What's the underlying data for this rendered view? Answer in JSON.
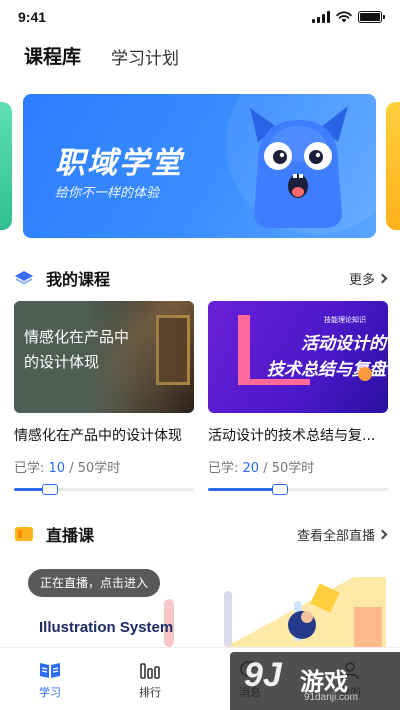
{
  "status_bar": {
    "time": "9:41"
  },
  "top_tabs": [
    {
      "label": "课程库",
      "active": true
    },
    {
      "label": "学习计划",
      "active": false
    }
  ],
  "banner": {
    "title": "职域学堂",
    "subtitle": "给你不一样的体验"
  },
  "my_courses": {
    "title": "我的课程",
    "more": "更多",
    "items": [
      {
        "thumb_text_line1": "情感化在产品中",
        "thumb_text_line2": "的设计体现",
        "title": "情感化在产品中的设计体现",
        "progress_prefix": "已学:",
        "learned": "10",
        "progress_suffix": "/ 50学时",
        "progress": 0.2
      },
      {
        "thumb_tag": "技能理论知识",
        "thumb_text_line1": "活动设计的",
        "thumb_text_line2": "技术总结与复盘",
        "title": "活动设计的技术总结与复...",
        "progress_prefix": "已学:",
        "learned": "20",
        "progress_suffix": "/ 50学时",
        "progress": 0.4
      }
    ]
  },
  "live": {
    "title": "直播课",
    "more": "查看全部直播",
    "pill": "正在直播，点击进入",
    "banner_title": "Illustration System"
  },
  "tab_bar": [
    {
      "label": "学习",
      "icon": "book-icon",
      "active": true
    },
    {
      "label": "排行",
      "icon": "bar-chart-icon",
      "active": false
    },
    {
      "label": "消息",
      "icon": "message-icon",
      "active": false
    },
    {
      "label": "我的",
      "icon": "profile-icon",
      "active": false
    }
  ],
  "watermark": {
    "number": "9J",
    "text": "游戏",
    "url": "91danji.com"
  },
  "colors": {
    "accent": "#2c6cf5",
    "banner": "#2c7cff"
  }
}
